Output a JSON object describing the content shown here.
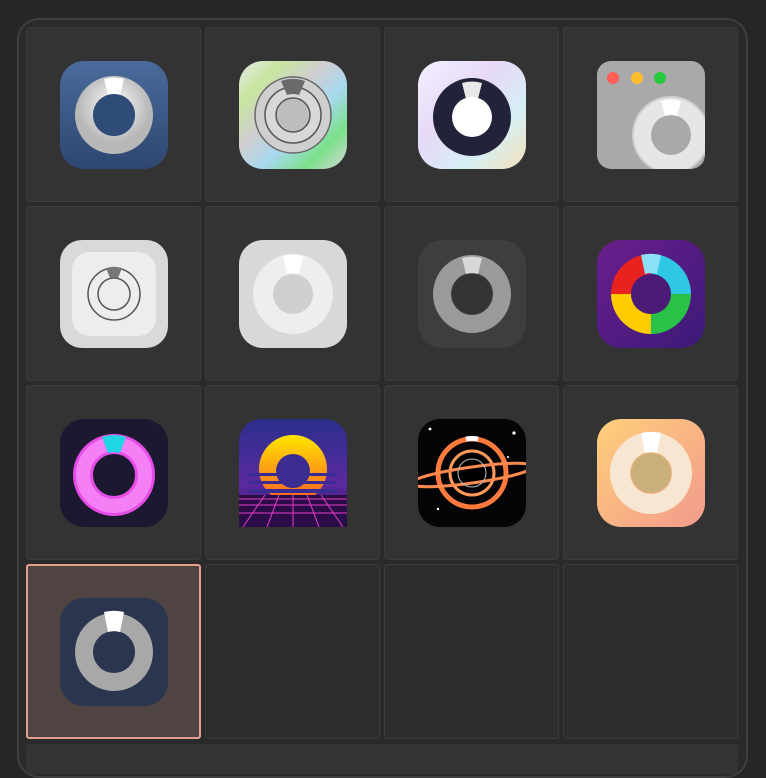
{
  "window": {
    "title": ""
  },
  "icon_grid": {
    "selected_index": 12,
    "items": [
      {
        "icon": "blue-ring-icon"
      },
      {
        "icon": "metallic-ring-icon"
      },
      {
        "icon": "pastel-ring-icon"
      },
      {
        "icon": "window-ring-icon"
      },
      {
        "icon": "light-outline-ring-icon"
      },
      {
        "icon": "white-ring-icon"
      },
      {
        "icon": "dark-ring-icon"
      },
      {
        "icon": "rainbow-ring-icon"
      },
      {
        "icon": "neon-ring-icon"
      },
      {
        "icon": "synthwave-sun-icon"
      },
      {
        "icon": "black-hole-icon"
      },
      {
        "icon": "peach-ring-icon"
      },
      {
        "icon": "navy-ring-icon"
      },
      {
        "icon": ""
      },
      {
        "icon": ""
      },
      {
        "icon": ""
      }
    ]
  },
  "colors": {
    "background": "#262626",
    "cell": "#333333",
    "selection_border": "#e39e8c"
  }
}
